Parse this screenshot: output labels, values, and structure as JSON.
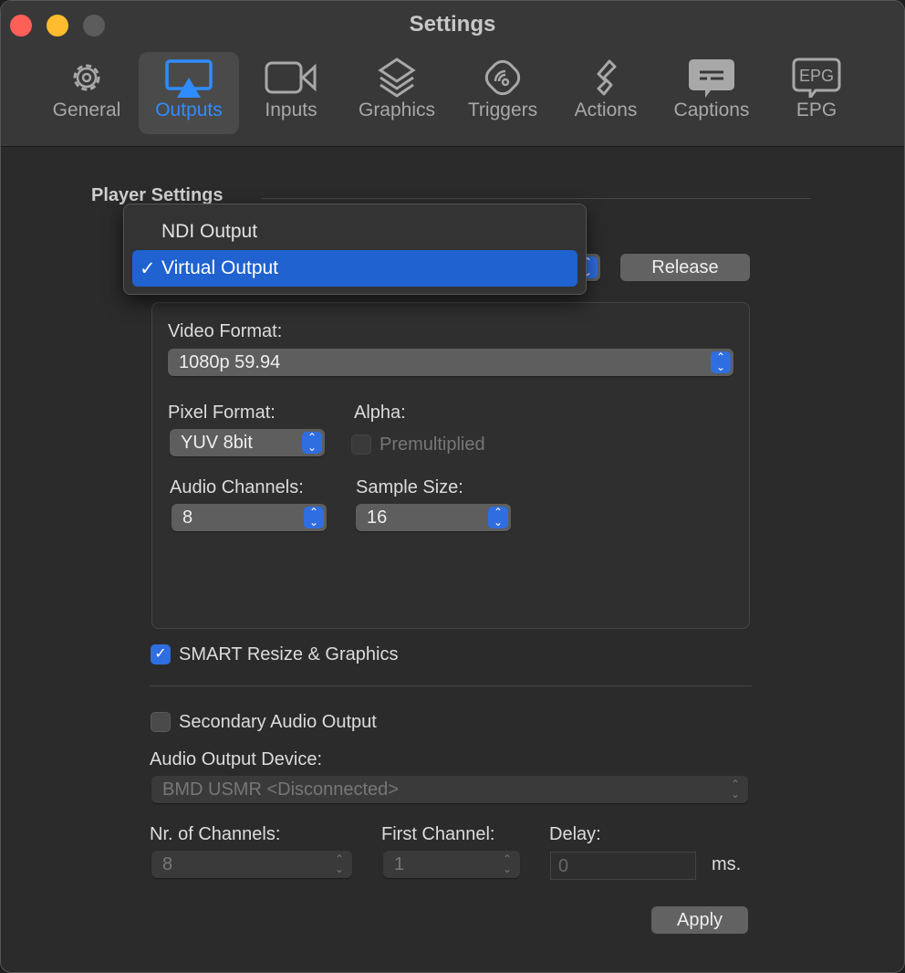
{
  "window": {
    "title": "Settings"
  },
  "tabs": [
    {
      "label": "General",
      "icon": "gear-icon"
    },
    {
      "label": "Outputs",
      "icon": "airplay-icon",
      "selected": true
    },
    {
      "label": "Inputs",
      "icon": "video-camera-icon"
    },
    {
      "label": "Graphics",
      "icon": "layers-cg-icon"
    },
    {
      "label": "Triggers",
      "icon": "trigger-icon"
    },
    {
      "label": "Actions",
      "icon": "actions-icon"
    },
    {
      "label": "Captions",
      "icon": "captions-icon"
    },
    {
      "label": "EPG",
      "icon": "epg-icon"
    }
  ],
  "player": {
    "section": "Player Settings",
    "menu": [
      {
        "label": "NDI Output"
      },
      {
        "label": "Virtual Output",
        "checked": true
      }
    ],
    "check": "✓",
    "release": "Release"
  },
  "video": {
    "format_label": "Video Format:",
    "format": "1080p 59.94",
    "pixel_label": "Pixel Format:",
    "pixel": "YUV 8bit",
    "alpha_label": "Alpha:",
    "premult": "Premultiplied",
    "audio_label": "Audio Channels:",
    "audio": "8",
    "sample_label": "Sample Size:",
    "sample": "16"
  },
  "smart": {
    "label": "SMART Resize & Graphics",
    "checked": true
  },
  "secondary": {
    "label": "Secondary Audio Output",
    "checked": false,
    "device_label": "Audio Output Device:",
    "device": "BMD USMR <Disconnected>",
    "channels_label": "Nr. of Channels:",
    "channels": "8",
    "first_label": "First Channel:",
    "first": "1",
    "delay_label": "Delay:",
    "delay": "0",
    "unit": "ms."
  },
  "apply": "Apply",
  "colors": {
    "accent": "#2f6ee0",
    "selected_tab": "#2f8cff"
  }
}
